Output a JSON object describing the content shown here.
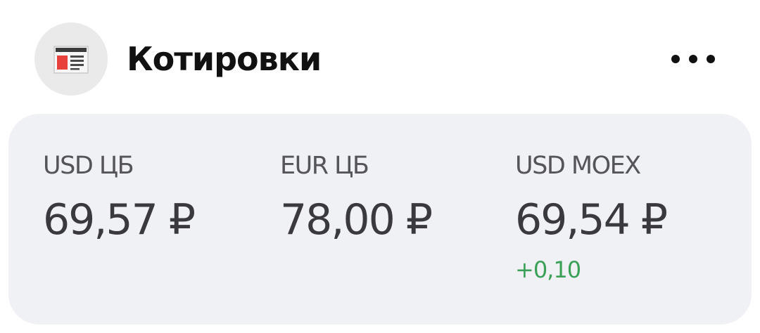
{
  "header": {
    "title": "Котировки",
    "icon": "newspaper-icon",
    "menu_icon": "more-dots-icon"
  },
  "colors": {
    "accent_red": "#e8403a",
    "positive": "#3aa057"
  },
  "quotes": [
    {
      "label": "USD ЦБ",
      "value": "69,57 ₽",
      "change": ""
    },
    {
      "label": "EUR ЦБ",
      "value": "78,00 ₽",
      "change": ""
    },
    {
      "label": "USD MOEX",
      "value": "69,54 ₽",
      "change": "+0,10"
    }
  ]
}
